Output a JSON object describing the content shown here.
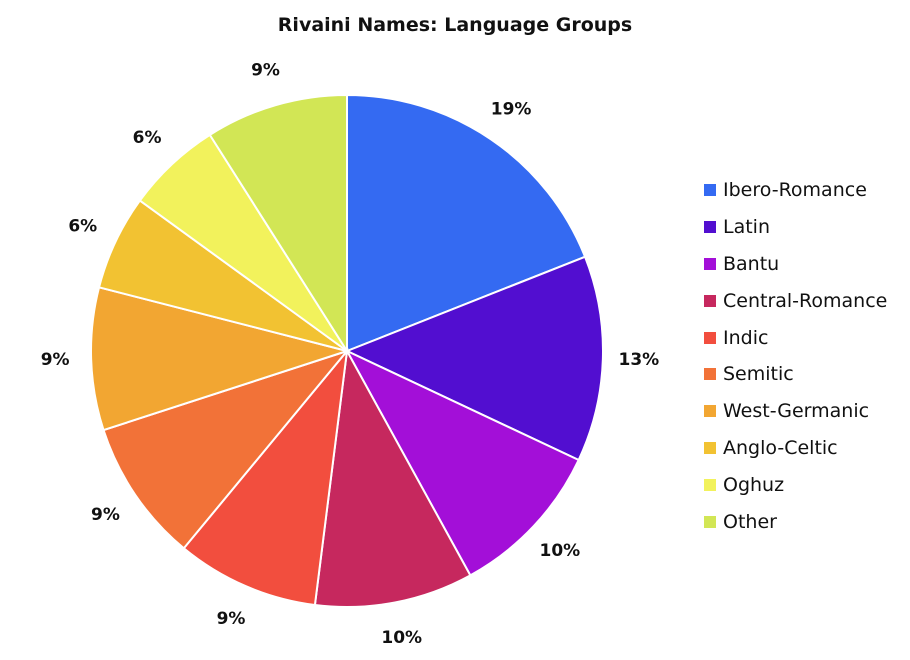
{
  "chart_data": {
    "type": "pie",
    "title": "Rivaini Names: Language Groups",
    "start": "top",
    "direction": "clockwise",
    "legend_position": "right",
    "slices": [
      {
        "label": "Ibero-Romance",
        "value": 19,
        "display": "19%",
        "color": "#346af2"
      },
      {
        "label": "Latin",
        "value": 13,
        "display": "13%",
        "color": "#520ed0"
      },
      {
        "label": "Bantu",
        "value": 10,
        "display": "10%",
        "color": "#a30fd8"
      },
      {
        "label": "Central-Romance",
        "value": 10,
        "display": "10%",
        "color": "#c6285e"
      },
      {
        "label": "Indic",
        "value": 9,
        "display": "9%",
        "color": "#f24e3e"
      },
      {
        "label": "Semitic",
        "value": 9,
        "display": "9%",
        "color": "#f27238"
      },
      {
        "label": "West-Germanic",
        "value": 9,
        "display": "9%",
        "color": "#f2a632"
      },
      {
        "label": "Anglo-Celtic",
        "value": 6,
        "display": "6%",
        "color": "#f2c232"
      },
      {
        "label": "Oghuz",
        "value": 6,
        "display": "6%",
        "color": "#f2f25c"
      },
      {
        "label": "Other",
        "value": 9,
        "display": "9%",
        "color": "#d2e655"
      }
    ]
  }
}
